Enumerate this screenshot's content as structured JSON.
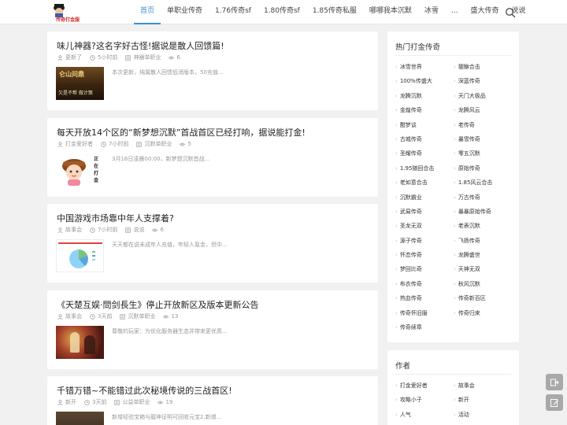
{
  "header": {
    "logo_text": "传奇打金服",
    "nav": [
      "首页",
      "单职业传奇",
      "1.76传奇sf",
      "1.80传奇sf",
      "1.85传奇私服",
      "哪哪我本沉默",
      "冰雪",
      "...",
      "盛大传奇",
      "说说"
    ],
    "active_index": 0
  },
  "articles": [
    {
      "title": "味儿神器?这名字好古怪!据说是散人回馈篇!",
      "author": "更新了",
      "time": "5小时前",
      "category": "神器单职业",
      "views": "6",
      "excerpt": "本次更新，纯属散人回馈低消版本，50充值...",
      "thumb_text_top": "仑山问鼎",
      "thumb_text_bottom": "欠是不帮  做计策"
    },
    {
      "title": "每天开放14个区的“新梦想沉默”首战首区已经打响，据说能打金!",
      "author": "打金爱好者",
      "time": "7小时前",
      "category": "沉默单职业",
      "views": "5",
      "excerpt": "3月16日凌晨00:00，新梦想沉默首战...",
      "thumb_side": "正在打金"
    },
    {
      "title": "中国游戏市场靠中年人支撑着?",
      "author": "故事会",
      "time": "7小时前",
      "category": "说说",
      "views": "6",
      "excerpt": "天天都在说未成年人充值，年轻人氪金，但中..."
    },
    {
      "title": "《天楚互娱·問剑長生》停止开放新区及版本更新公告",
      "author": "故事会",
      "time": "3天前",
      "category": "沉默单职业",
      "views": "13",
      "excerpt": "尊敬的玩家：为优化服务器生态并带来更优质..."
    },
    {
      "title": "千错万错~不能错过此次秘境传说的三战首区!",
      "author": "新开",
      "time": "3天前",
      "category": "公益单职业",
      "views": "19",
      "excerpt": "新增经验宝箱与龍神证明可回收元宝2.新增..."
    }
  ],
  "sidebar": {
    "hot": {
      "title": "热门打金传奇",
      "items": [
        "冰雪世界",
        "貔貅合击",
        "100%传盛大",
        "深蓝传奇",
        "龙腾沉默",
        "天门大极品",
        "金煌传奇",
        "龙腾风云",
        "酣梦谈",
        "老传奇",
        "古城传奇",
        "暴雪传奇",
        "圣耀传奇",
        "零五沉默",
        "1.95随回合击",
        "原始传奇",
        "老如意合击",
        "1.85风云合击",
        "沉默霸业",
        "万古传奇",
        "武易传奇",
        "暴暴原始传奇",
        "圣龙无双",
        "老表沉默",
        "源子传奇",
        "飞扬传奇",
        "怀恋传奇",
        "龙腾盛世",
        "梦回比奇",
        "天神无双",
        "布衣传奇",
        "秋风沉默",
        "热血传奇",
        "传奇新百区",
        "传奇怀旧服",
        "传奇归来",
        "传奇续章"
      ]
    },
    "authors": {
      "title": "作者",
      "items": [
        "打金爱好者",
        "故事会",
        "攻略小子",
        "新开",
        "人气",
        "活动"
      ]
    }
  },
  "colors": {
    "accent": "#3b8fd9",
    "bg": "#f1f1f1",
    "card": "#ffffff"
  }
}
